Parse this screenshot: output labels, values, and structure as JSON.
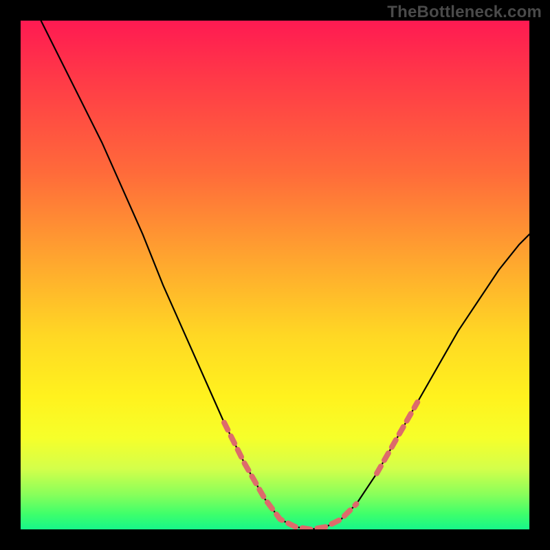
{
  "watermark": "TheBottleneck.com",
  "chart_data": {
    "type": "line",
    "title": "",
    "xlabel": "",
    "ylabel": "",
    "xlim": [
      0,
      100
    ],
    "ylim": [
      0,
      100
    ],
    "grid": false,
    "series": [
      {
        "name": "curve",
        "color": "#000000",
        "points": [
          {
            "x": 4,
            "y": 100
          },
          {
            "x": 8,
            "y": 92
          },
          {
            "x": 12,
            "y": 84
          },
          {
            "x": 16,
            "y": 76
          },
          {
            "x": 20,
            "y": 67
          },
          {
            "x": 24,
            "y": 58
          },
          {
            "x": 28,
            "y": 48
          },
          {
            "x": 32,
            "y": 39
          },
          {
            "x": 36,
            "y": 30
          },
          {
            "x": 40,
            "y": 21
          },
          {
            "x": 44,
            "y": 13
          },
          {
            "x": 48,
            "y": 6
          },
          {
            "x": 51,
            "y": 2
          },
          {
            "x": 54,
            "y": 0.5
          },
          {
            "x": 57,
            "y": 0
          },
          {
            "x": 60,
            "y": 0.5
          },
          {
            "x": 63,
            "y": 2
          },
          {
            "x": 66,
            "y": 5
          },
          {
            "x": 70,
            "y": 11
          },
          {
            "x": 74,
            "y": 18
          },
          {
            "x": 78,
            "y": 25
          },
          {
            "x": 82,
            "y": 32
          },
          {
            "x": 86,
            "y": 39
          },
          {
            "x": 90,
            "y": 45
          },
          {
            "x": 94,
            "y": 51
          },
          {
            "x": 98,
            "y": 56
          },
          {
            "x": 100,
            "y": 58
          }
        ]
      },
      {
        "name": "dash-overlay-left",
        "color": "#e06868",
        "dashed": true,
        "points": [
          {
            "x": 40,
            "y": 21
          },
          {
            "x": 44,
            "y": 13
          },
          {
            "x": 48,
            "y": 6
          },
          {
            "x": 51,
            "y": 2
          },
          {
            "x": 54,
            "y": 0.5
          },
          {
            "x": 57,
            "y": 0
          },
          {
            "x": 60,
            "y": 0.5
          },
          {
            "x": 63,
            "y": 2
          },
          {
            "x": 66,
            "y": 5
          }
        ]
      },
      {
        "name": "dash-overlay-right",
        "color": "#e06868",
        "dashed": true,
        "points": [
          {
            "x": 70,
            "y": 11
          },
          {
            "x": 74,
            "y": 18
          },
          {
            "x": 78,
            "y": 25
          }
        ]
      }
    ]
  }
}
